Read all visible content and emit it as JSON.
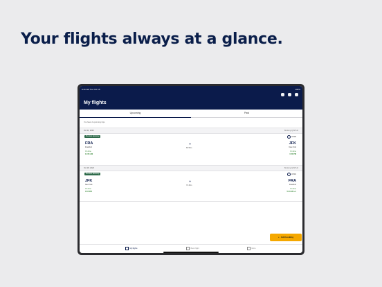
{
  "headline": "Your flights always at a glance.",
  "status": {
    "left": "9:41 AM  Tue Oct 15",
    "right": "100%"
  },
  "app": {
    "title": "My flights"
  },
  "tabs": [
    {
      "label": "Upcoming",
      "selected": true
    },
    {
      "label": "Past",
      "selected": false
    }
  ],
  "note": "You have 2 upcoming trips",
  "flights": [
    {
      "date": "Oct 11, 2023",
      "booking": "Booking QJSTH4",
      "class": "Premium Economy",
      "airline": "LH400",
      "from": {
        "code": "FRA",
        "city": "Frankfurt",
        "status": "On time",
        "time": "11:05 AM"
      },
      "to": {
        "code": "JFK",
        "city": "New York",
        "status": "On time",
        "time": "1:50 PM"
      },
      "duration": "8h 55m"
    },
    {
      "date": "Oct 18, 2023",
      "booking": "Booking QJSTH4",
      "class": "Premium Economy",
      "airline": "LH401",
      "from": {
        "code": "JFK",
        "city": "New York",
        "status": "On time",
        "time": "3:55 PM"
      },
      "to": {
        "code": "FRA",
        "city": "Frankfurt",
        "status": "On time",
        "time": "5:40 AM +1"
      },
      "duration": "7h 45m"
    }
  ],
  "add_button": "Add booking",
  "nav": [
    {
      "label": "My flights",
      "active": true
    },
    {
      "label": "Book flight",
      "active": false
    },
    {
      "label": "More",
      "active": false
    }
  ],
  "colors": {
    "navy": "#0b1b4b",
    "accent": "#f5a800",
    "badge": "#2f6b4b",
    "ontime": "#3a8a3a"
  }
}
